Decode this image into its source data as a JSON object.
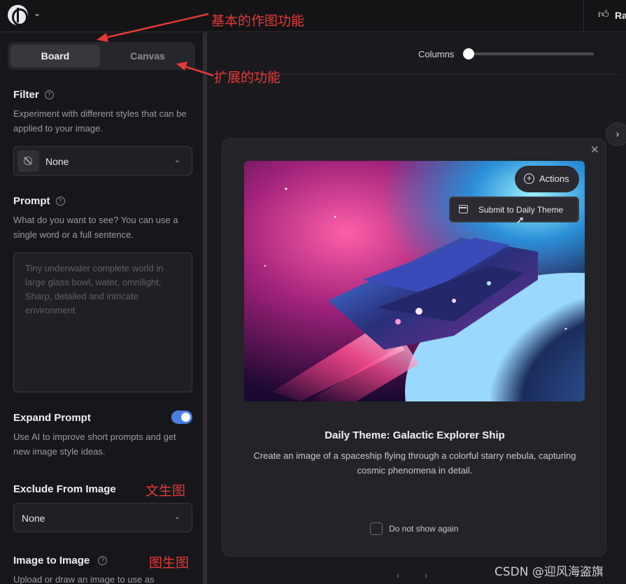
{
  "topbar": {
    "right_label": "Ra"
  },
  "annotations": {
    "basic": "基本的作图功能",
    "extended": "扩展的功能",
    "text_to_image": "文生图",
    "image_to_image": "图生图"
  },
  "sidebar": {
    "tabs": [
      "Board",
      "Canvas"
    ],
    "active_tab": "Board",
    "filter": {
      "title": "Filter",
      "desc": "Experiment with different styles that can be applied to your image.",
      "value": "None"
    },
    "prompt": {
      "title": "Prompt",
      "desc": "What do you want to see? You can use a single word or a full sentence.",
      "placeholder": "Tiny underwater complete world in large glass bowl, water, omnilight, Sharp, detailed and intricate environment"
    },
    "expand_prompt": {
      "title": "Expand Prompt",
      "desc": "Use AI to improve short prompts and get new image style ideas.",
      "enabled": true
    },
    "exclude": {
      "title": "Exclude From Image",
      "value": "None"
    },
    "img2img": {
      "title": "Image to Image",
      "desc": "Upload or draw an image to use as"
    }
  },
  "main": {
    "columns_label": "Columns",
    "columns_level": 0
  },
  "modal": {
    "actions_label": "Actions",
    "menu_item": "Submit to Daily Theme",
    "title": "Daily Theme: Galactic Explorer Ship",
    "desc": "Create an image of a spaceship flying through a colorful starry nebula, capturing cosmic phenomena in detail.",
    "checkbox_label": "Do not show again",
    "checkbox_checked": false
  },
  "watermark": "CSDN @迎风海盗旗",
  "colors": {
    "accent": "#4a7fe0",
    "annotation": "#e53935",
    "background": "#1a1a1e"
  }
}
